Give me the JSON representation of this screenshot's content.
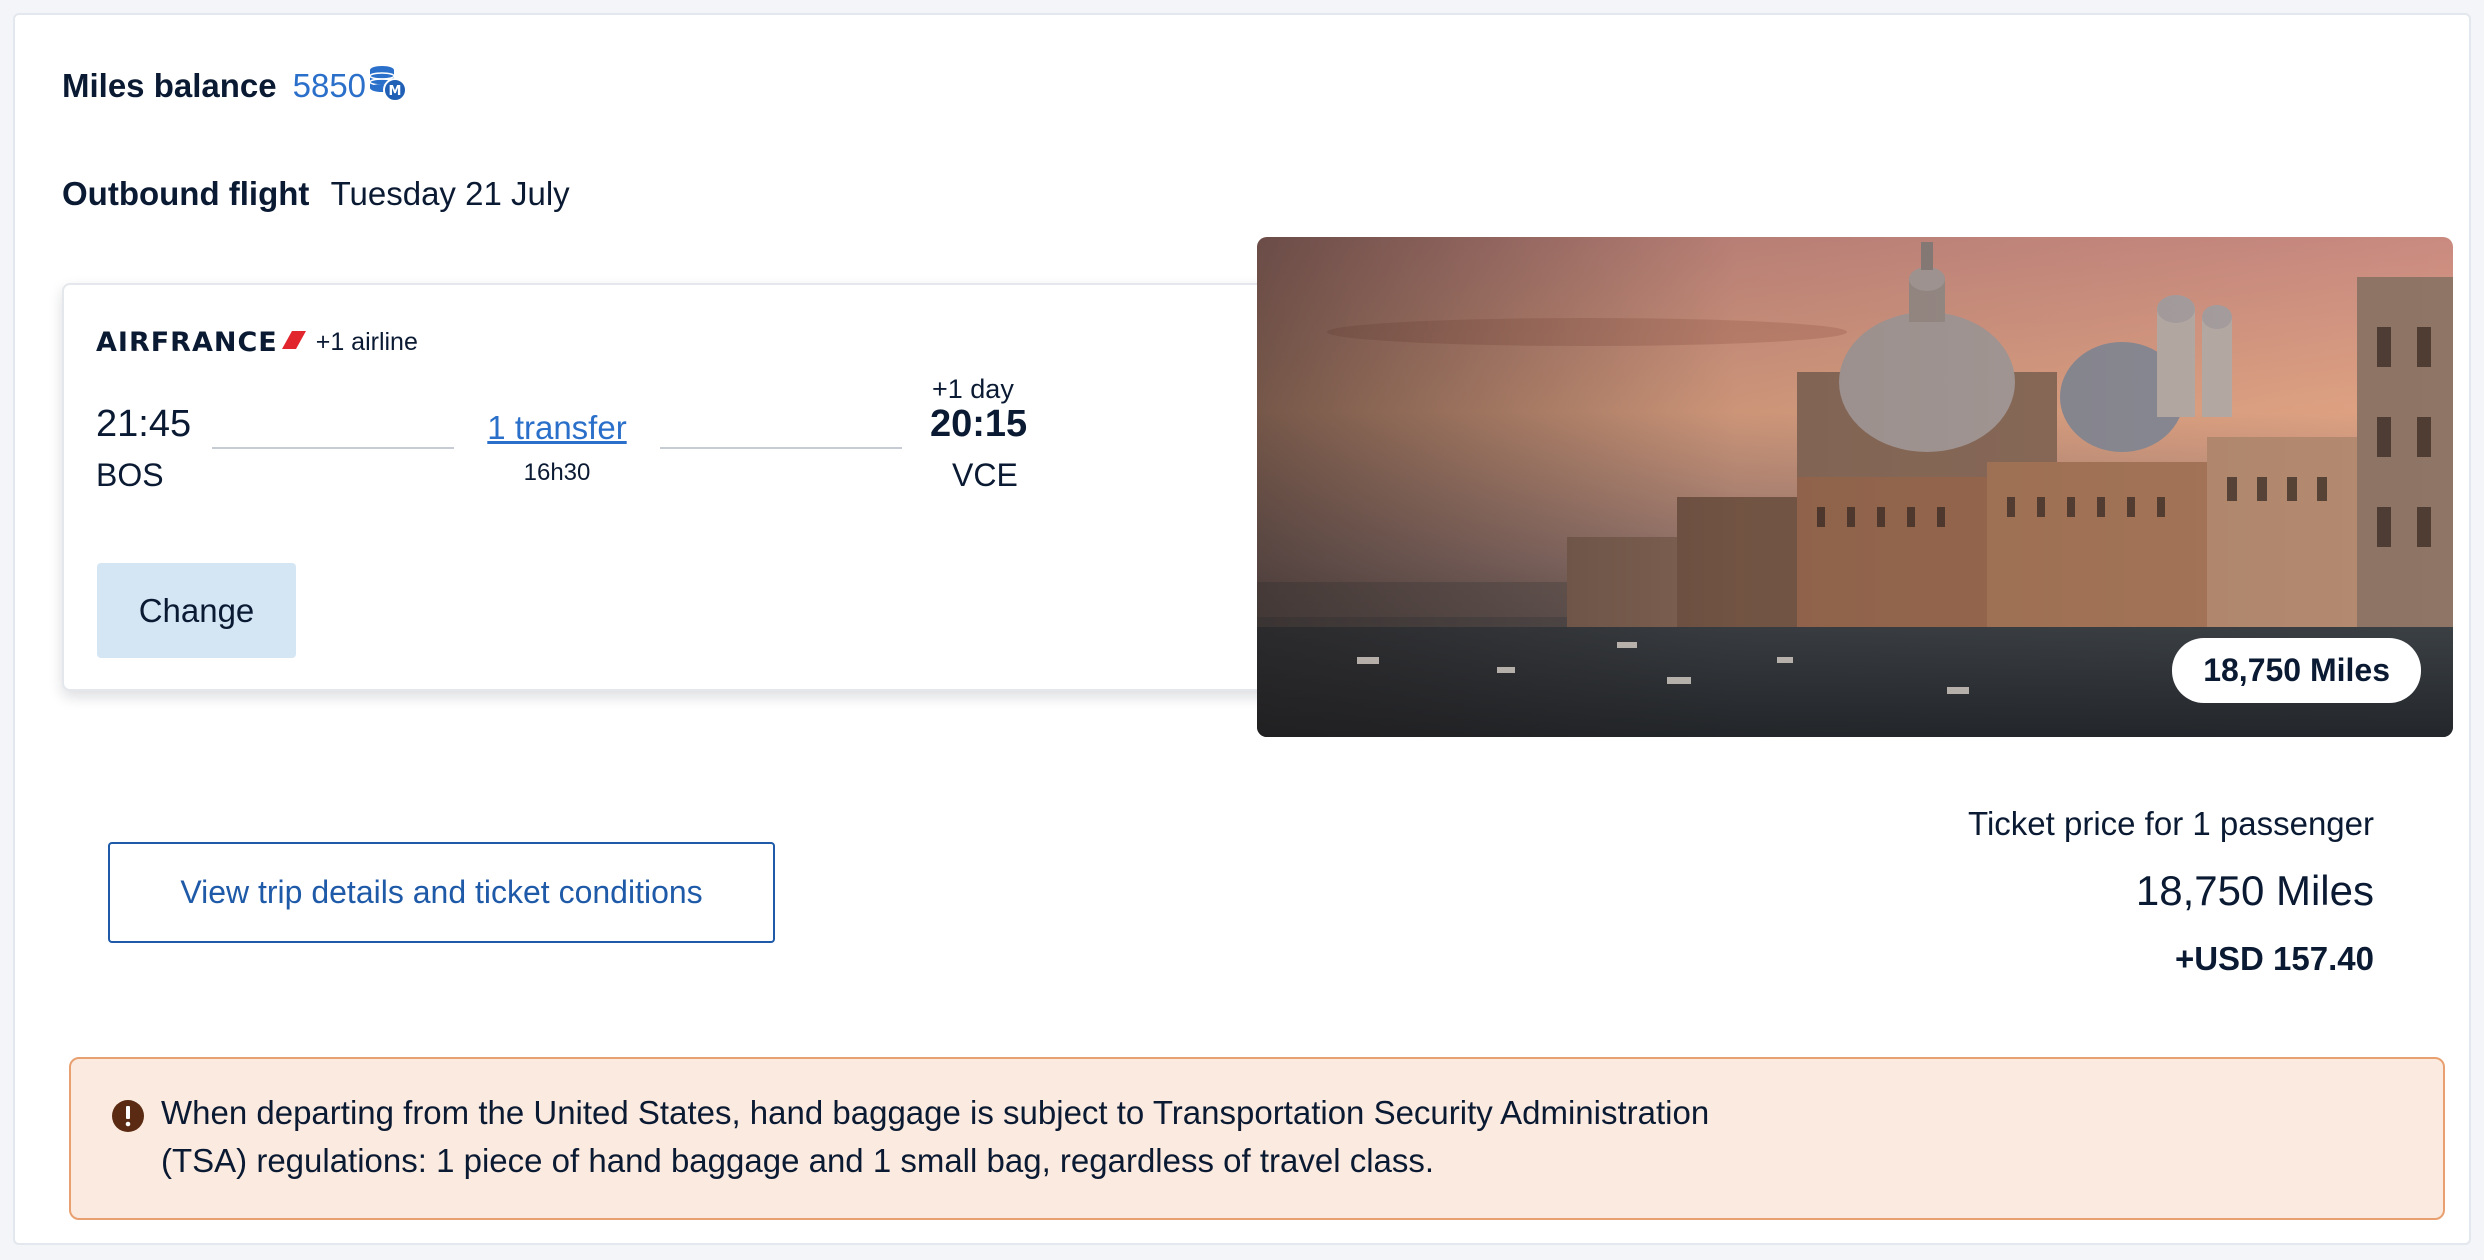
{
  "miles_balance": {
    "label": "Miles balance",
    "value": "5850",
    "icon": "miles-coins-icon",
    "accent_color": "#2a6fc9"
  },
  "outbound": {
    "label": "Outbound flight",
    "date": "Tuesday 21 July"
  },
  "flight": {
    "airline_logo_text": "AIRFRANCE",
    "extra_airlines": "+1 airline",
    "departure_time": "21:45",
    "departure_code": "BOS",
    "transfer_label": "1 transfer",
    "duration": "16h30",
    "day_offset": "+1 day",
    "arrival_time": "20:15",
    "arrival_code": "VCE",
    "change_label": "Change"
  },
  "destination_image": {
    "price_badge": "18,750 Miles"
  },
  "details_button_label": "View trip details and ticket conditions",
  "ticket": {
    "price_label": "Ticket price for 1 passenger",
    "miles": "18,750 Miles",
    "cash": "+USD 157.40"
  },
  "notice": {
    "icon": "alert-icon",
    "text": "When departing from the United States, hand baggage is subject to Transportation Security Administration (TSA) regulations: 1 piece of hand baggage and 1 small bag, regardless of travel class.",
    "background_color": "#fbeadf",
    "border_color": "#e9a070"
  }
}
